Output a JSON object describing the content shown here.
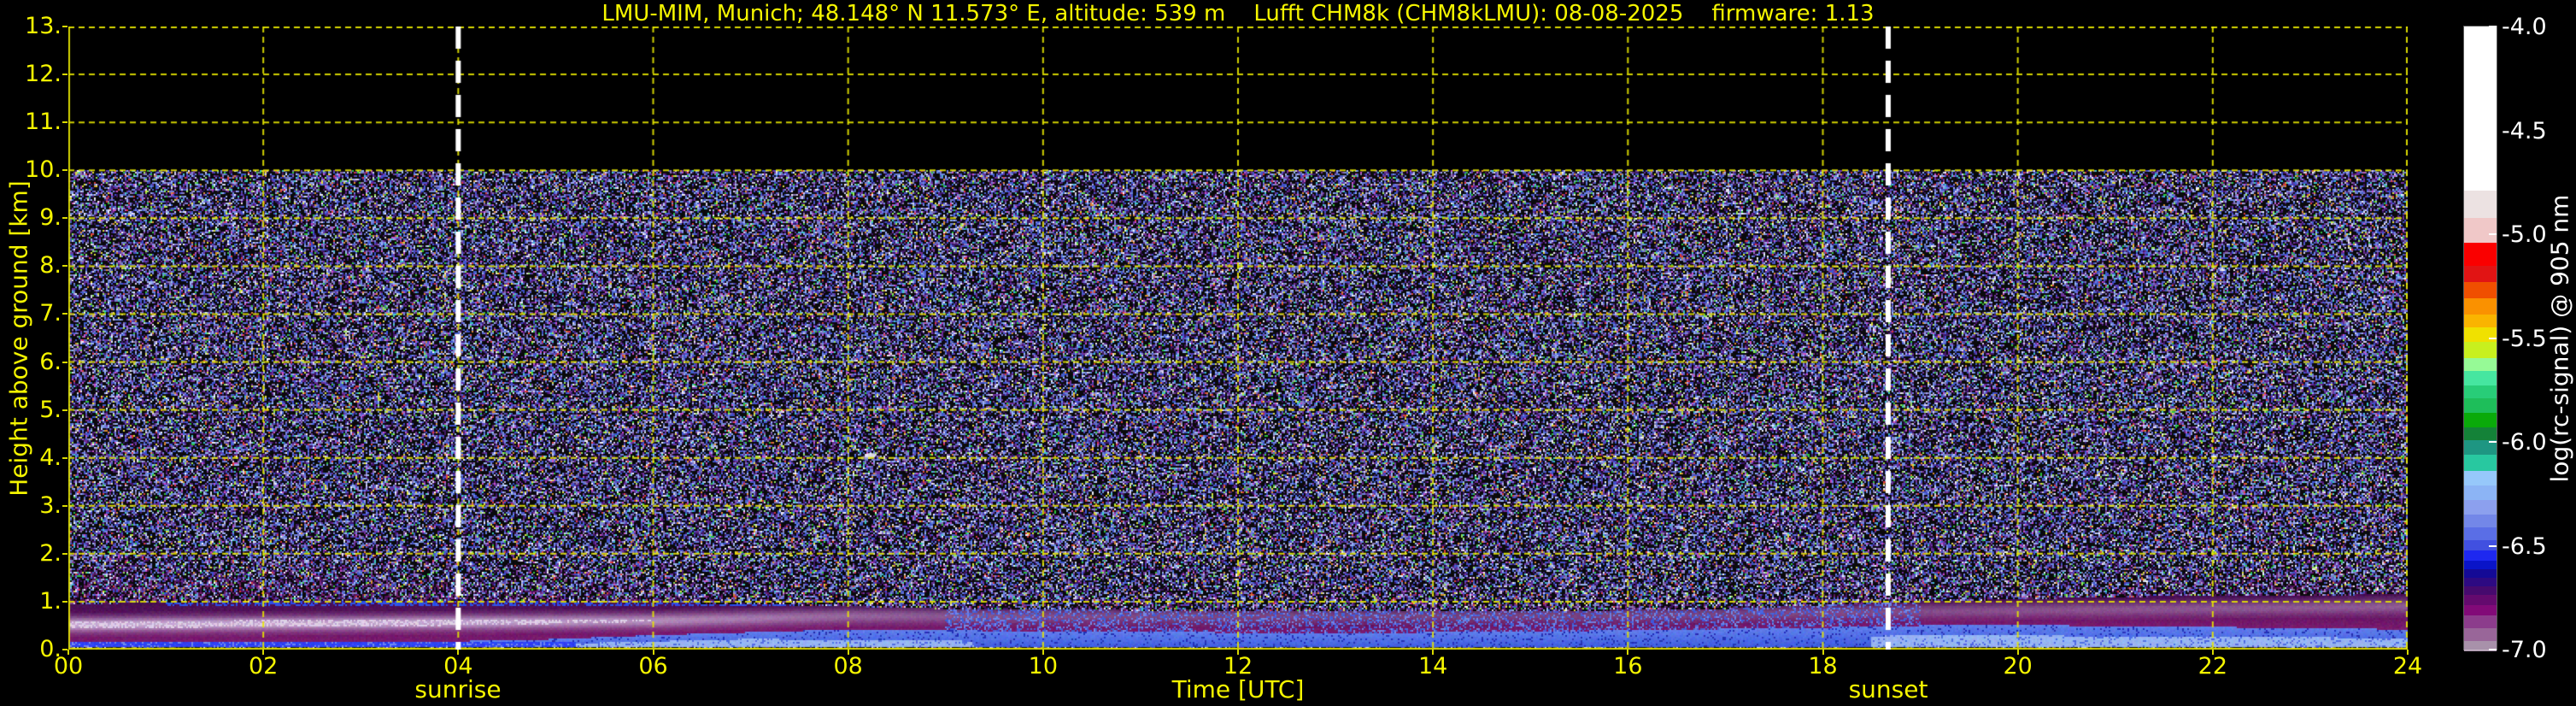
{
  "title": "LMU-MIM, Munich; 48.148° N 11.573° E, altitude: 539 m    Lufft CHM8k (CHM8kLMU): 08-08-2025    firmware: 1.13",
  "axes": {
    "x": {
      "label": "Time [UTC]",
      "ticks": [
        "00",
        "02",
        "04",
        "06",
        "08",
        "10",
        "12",
        "14",
        "16",
        "18",
        "20",
        "22",
        "24"
      ],
      "range": [
        0,
        24
      ]
    },
    "y": {
      "label": "Height above ground [km]",
      "ticks": [
        "0.",
        "1.",
        "2.",
        "3.",
        "4.",
        "5.",
        "6.",
        "7.",
        "8.",
        "9.",
        "10.",
        "11.",
        "12.",
        "13."
      ],
      "range": [
        0,
        13
      ]
    }
  },
  "annotations": {
    "sunrise": {
      "label": "sunrise",
      "time_utc": 4.0
    },
    "sunset": {
      "label": "sunset",
      "time_utc": 18.67
    }
  },
  "colorbar": {
    "label": "log(rc-signal) @ 905 nm",
    "ticks": [
      "-4.0",
      "-4.5",
      "-5.0",
      "-5.5",
      "-6.0",
      "-6.5",
      "-7.0"
    ],
    "range": [
      -4.0,
      -7.0
    ],
    "segments": [
      {
        "c": "#ffffff",
        "to": -4.79
      },
      {
        "c": "#ece2e2",
        "to": -4.92
      },
      {
        "c": "#f0c8c8",
        "to": -5.04
      },
      {
        "c": "#fa0000",
        "to": -5.15
      },
      {
        "c": "#e11414",
        "to": -5.23
      },
      {
        "c": "#f04f00",
        "to": -5.31
      },
      {
        "c": "#fa9100",
        "to": -5.39
      },
      {
        "c": "#fab400",
        "to": -5.45
      },
      {
        "c": "#f0e100",
        "to": -5.52
      },
      {
        "c": "#c8f01e",
        "to": -5.6
      },
      {
        "c": "#96fa96",
        "to": -5.66
      },
      {
        "c": "#46e6a0",
        "to": -5.73
      },
      {
        "c": "#28cd78",
        "to": -5.79
      },
      {
        "c": "#1ebe5a",
        "to": -5.86
      },
      {
        "c": "#0aaa0a",
        "to": -5.93
      },
      {
        "c": "#148238",
        "to": -5.99
      },
      {
        "c": "#1e9682",
        "to": -6.06
      },
      {
        "c": "#28c8a0",
        "to": -6.14
      },
      {
        "c": "#96c8fa",
        "to": -6.21
      },
      {
        "c": "#8cb4f5",
        "to": -6.28
      },
      {
        "c": "#8ca0ee",
        "to": -6.35
      },
      {
        "c": "#7387e8",
        "to": -6.41
      },
      {
        "c": "#5a6ee6",
        "to": -6.47
      },
      {
        "c": "#4150e0",
        "to": -6.52
      },
      {
        "c": "#1e28f0",
        "to": -6.57
      },
      {
        "c": "#0a14c8",
        "to": -6.61
      },
      {
        "c": "#140a96",
        "to": -6.65
      },
      {
        "c": "#2d0a82",
        "to": -6.69
      },
      {
        "c": "#460a6e",
        "to": -6.73
      },
      {
        "c": "#640a6e",
        "to": -6.78
      },
      {
        "c": "#820a78",
        "to": -6.83
      },
      {
        "c": "#8c3c8c",
        "to": -6.89
      },
      {
        "c": "#996699",
        "to": -6.95
      },
      {
        "c": "#a891aa",
        "to": -7.0
      }
    ]
  },
  "colors": {
    "background": "#000000",
    "axis_text": "#f5f500",
    "grid": "#e6e600",
    "sun_line": "#ffffff",
    "colorbar_text": "#ffffff"
  },
  "chart_data": {
    "type": "heatmap",
    "title": "LMU-MIM, Munich; 48.148° N 11.573° E, altitude: 539 m    Lufft CHM8k (CHM8kLMU): 08-08-2025    firmware: 1.13",
    "station": "LMU-MIM, Munich",
    "latitude": "48.148° N",
    "longitude": "11.573° E",
    "altitude_m": 539,
    "instrument": "Lufft CHM8k",
    "instrument_id": "CHM8kLMU",
    "date": "08-08-2025",
    "firmware": "1.13",
    "xlabel": "Time [UTC]",
    "ylabel": "Height above ground [km]",
    "zlabel": "log(rc-signal) @ 905 nm",
    "xlim": [
      0,
      24
    ],
    "ylim": [
      0,
      13
    ],
    "zlim": [
      -4.0,
      -7.0
    ],
    "grid": "dashed yellow, x every 2 h, y every 1 km",
    "data_top_km": 10,
    "sunrise_utc": 4.0,
    "sunset_utc": 18.67,
    "features": [
      "random speckle noise (log rc-signal ~ -6.5 to -7) fills 0-10 km; black above 10 km (max range)",
      "strong aerosol/boundary layer below ~1.3 km all day (magenta/purple, ~-6.8)",
      "bright lavender residual layer band ~0.4-0.7 km from 00-09 UTC",
      "thin strong blue surface signal ~0.1 km, strongest 00-06 UTC",
      "blue convective layer grows from surface after sunrise to ~0.4-0.5 km",
      "evening light-blue shallow layer 0-0.3 km after ~19 UTC under dark magenta band to ~1.1 km",
      "faint blue residual-layer top streak near 1.0 km from 01-09 UTC",
      "small white point echo at ~08:14 UTC, ~4.05 km"
    ],
    "layers_keyframes": {
      "blue_top_km": [
        [
          0,
          0.16
        ],
        [
          4.5,
          0.18
        ],
        [
          6,
          0.3
        ],
        [
          8,
          0.42
        ],
        [
          10,
          0.38
        ],
        [
          13,
          0.34
        ],
        [
          16,
          0.4
        ],
        [
          18,
          0.46
        ],
        [
          19.5,
          0.52
        ],
        [
          22,
          0.47
        ],
        [
          24,
          0.42
        ]
      ],
      "lightblue_top_km": [
        [
          0,
          0.1
        ],
        [
          5,
          0.12
        ],
        [
          7,
          0.22
        ],
        [
          9,
          0.18
        ],
        [
          12,
          0.15
        ],
        [
          16,
          0.18
        ],
        [
          19,
          0.3
        ],
        [
          21,
          0.28
        ],
        [
          24,
          0.24
        ]
      ],
      "magenta_top_km": [
        [
          0,
          0.95
        ],
        [
          2,
          1.0
        ],
        [
          5,
          1.0
        ],
        [
          7,
          0.95
        ],
        [
          9,
          0.85
        ],
        [
          12,
          0.8
        ],
        [
          15,
          0.8
        ],
        [
          17,
          0.85
        ],
        [
          19,
          1.0
        ],
        [
          21,
          1.1
        ],
        [
          24,
          1.15
        ]
      ],
      "haze_top_km": [
        [
          0,
          2.3
        ],
        [
          3,
          2.1
        ],
        [
          6,
          1.7
        ],
        [
          9,
          1.35
        ],
        [
          12,
          1.2
        ],
        [
          16,
          1.25
        ],
        [
          19,
          1.5
        ],
        [
          22,
          1.9
        ],
        [
          24,
          2.0
        ]
      ],
      "lavender_center_km": [
        [
          0,
          0.52
        ],
        [
          3,
          0.55
        ],
        [
          6,
          0.6
        ],
        [
          8,
          0.7
        ],
        [
          12,
          0.7
        ],
        [
          16,
          0.72
        ],
        [
          19,
          0.8
        ],
        [
          24,
          0.9
        ]
      ],
      "lavender_amp": [
        [
          0,
          0.95
        ],
        [
          4,
          0.9
        ],
        [
          6,
          0.75
        ],
        [
          8,
          0.5
        ],
        [
          10,
          0.35
        ],
        [
          14,
          0.3
        ],
        [
          17,
          0.3
        ],
        [
          19,
          0.35
        ],
        [
          21,
          0.4
        ],
        [
          24,
          0.45
        ]
      ]
    }
  }
}
